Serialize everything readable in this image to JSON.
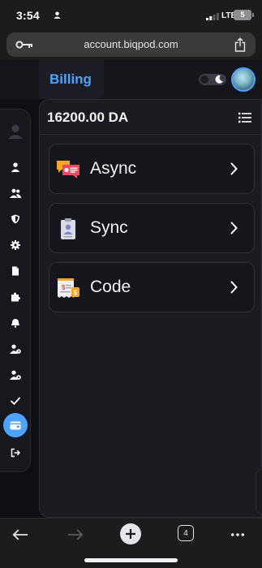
{
  "status_bar": {
    "time": "3:54",
    "network": "LTE",
    "battery": "5"
  },
  "browser": {
    "url": "account.biqpod.com",
    "open_tabs": "4"
  },
  "header": {
    "title": "Billing"
  },
  "balance": {
    "amount": "16200.00 DA"
  },
  "cards": [
    {
      "label": "Async",
      "icon": "messages-invoice-icon"
    },
    {
      "label": "Sync",
      "icon": "clipboard-user-icon"
    },
    {
      "label": "Code",
      "icon": "receipt-dollar-icon"
    }
  ],
  "sidebar": {
    "items": [
      {
        "icon": "user-icon"
      },
      {
        "icon": "users-icon"
      },
      {
        "icon": "shield-icon"
      },
      {
        "icon": "gear-icon"
      },
      {
        "icon": "file-icon"
      },
      {
        "icon": "puzzle-icon"
      },
      {
        "icon": "bell-icon"
      },
      {
        "icon": "user-clock-icon"
      },
      {
        "icon": "user-cog-icon"
      },
      {
        "icon": "check-icon"
      },
      {
        "icon": "wallet-icon",
        "active": true
      },
      {
        "icon": "logout-icon"
      }
    ]
  },
  "colors": {
    "accent": "#4da3ff",
    "background": "#0e0f12",
    "panel": "#1b1c22"
  }
}
